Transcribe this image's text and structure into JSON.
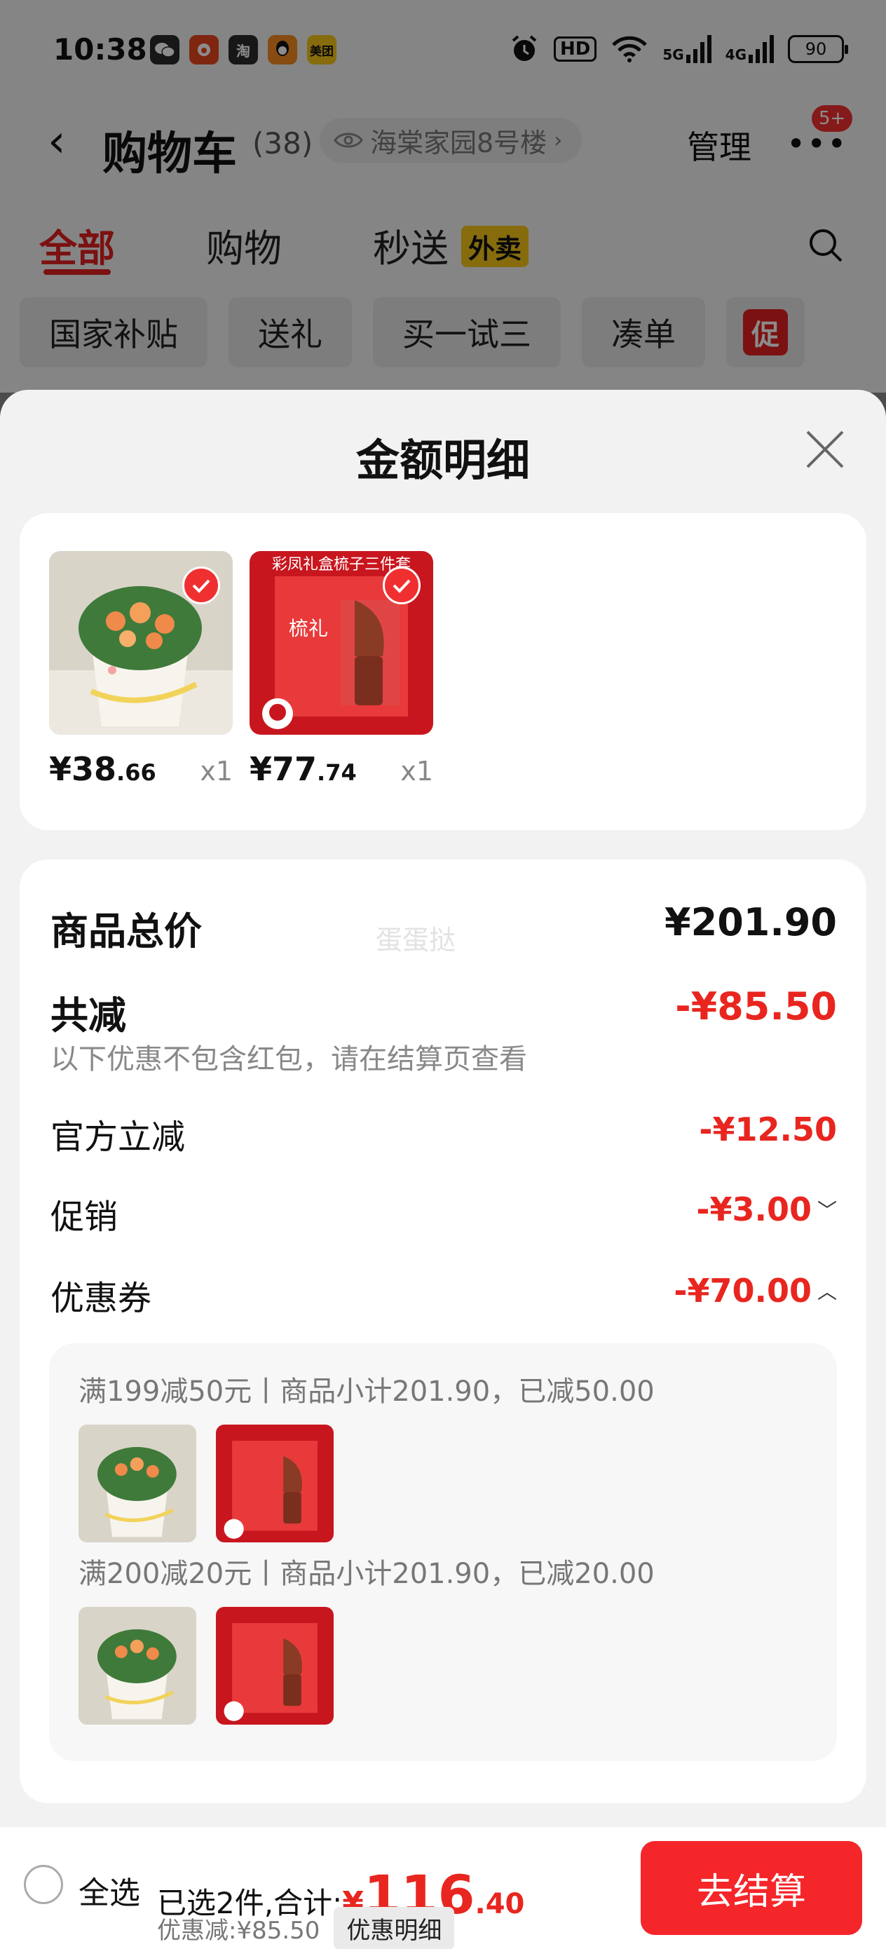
{
  "status_bar": {
    "time": "10:38",
    "apps": [
      {
        "name": "wechat-icon",
        "label": "",
        "color": "#2b2b2b"
      },
      {
        "name": "weibo-icon",
        "label": "",
        "color": "#e8461f"
      },
      {
        "name": "taobao-icon",
        "label": "淘",
        "color": "#2b2b2b"
      },
      {
        "name": "qq-icon",
        "label": "",
        "color": "#f58a1f"
      },
      {
        "name": "meituan-icon",
        "label": "美团",
        "color": "#f5c518"
      }
    ],
    "network_hd": "HD",
    "net_5g": "5G",
    "net_4g": "4G",
    "battery": "90"
  },
  "nav": {
    "title": "购物车",
    "count": "(38)",
    "address": "海棠家园8号楼",
    "manage": "管理",
    "more_badge": "5+"
  },
  "tabs": [
    {
      "label": "全部"
    },
    {
      "label": "购物"
    },
    {
      "label": "秒送"
    }
  ],
  "tab_badge": "外卖",
  "chips": [
    "国家补贴",
    "送礼",
    "买一试三",
    "凑单"
  ],
  "promo_chip": {
    "tag": "促"
  },
  "sheet": {
    "title": "金额明细",
    "items": [
      {
        "price_int": "¥38",
        "price_dec": ".66",
        "qty": "x1"
      },
      {
        "price_int": "¥77",
        "price_dec": ".74",
        "qty": "x1"
      }
    ],
    "product_box_text": "彩凤礼盒梳子三件套",
    "box_glyph": "梳礼",
    "watermark": "蛋蛋挞",
    "total_label": "商品总价",
    "total_amount": "¥201.90",
    "reduce_label": "共减",
    "reduce_amount": "-¥85.50",
    "reduce_note": "以下优惠不包含红包，请在结算页查看",
    "official_label": "官方立减",
    "official_amount": "-¥12.50",
    "promo_label": "促销",
    "promo_amount": "-¥3.00",
    "coupon_label": "优惠券",
    "coupon_amount": "-¥70.00",
    "coupons": [
      {
        "text": "满199减50元丨商品小计201.90，已减50.00"
      },
      {
        "text": "满200减20元丨商品小计201.90，已减20.00"
      }
    ]
  },
  "footer": {
    "select_all": "全选",
    "selected_text": "已选2件,合计:",
    "currency": "¥",
    "total_int": "116",
    "total_dec": ".40",
    "discount_text": "优惠减:¥85.50",
    "detail_button": "优惠明细",
    "checkout": "去结算"
  },
  "colors": {
    "accent": "#e8261f",
    "checkout": "#f5262a",
    "tab_badge": "#f5c518"
  }
}
